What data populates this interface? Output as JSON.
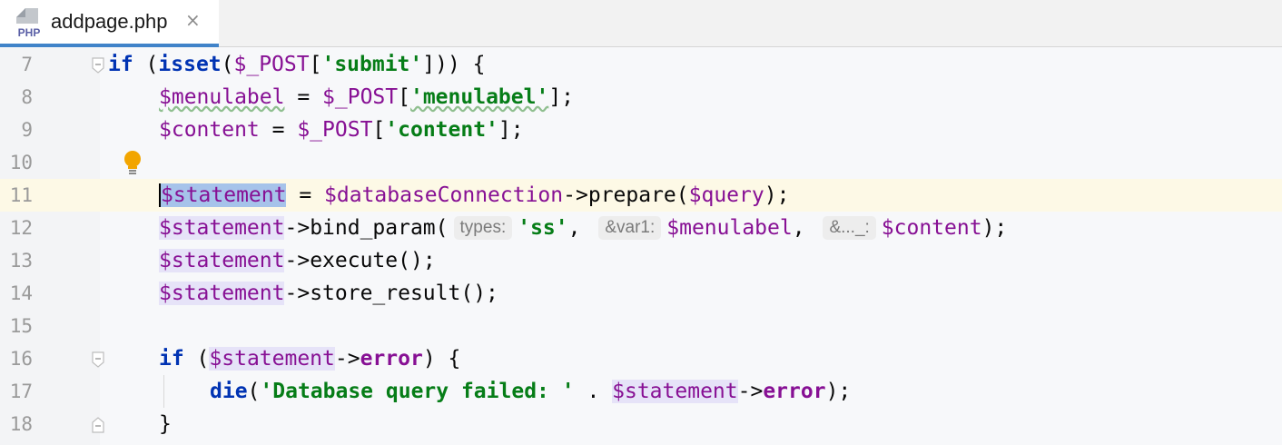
{
  "tab": {
    "filename": "addpage.php",
    "icon": "php-file-icon",
    "close": "×",
    "badge": "PHP"
  },
  "lines": [
    {
      "n": "7"
    },
    {
      "n": "8"
    },
    {
      "n": "9"
    },
    {
      "n": "10"
    },
    {
      "n": "11"
    },
    {
      "n": "12"
    },
    {
      "n": "13"
    },
    {
      "n": "14"
    },
    {
      "n": "15"
    },
    {
      "n": "16"
    },
    {
      "n": "17"
    },
    {
      "n": "18"
    }
  ],
  "tokens": {
    "l7": [
      "if",
      " (",
      "isset",
      "(",
      "$_POST",
      "[",
      "'submit'",
      "])) {"
    ],
    "l8": [
      "$menulabel",
      " = ",
      "$_POST",
      "[",
      "'menulabel'",
      "];"
    ],
    "l9": [
      "$content",
      " = ",
      "$_POST",
      "[",
      "'content'",
      "];"
    ],
    "l11": [
      "$statement",
      " = ",
      "$databaseConnection",
      "->",
      "prepare",
      "(",
      "$query",
      ");"
    ],
    "l12": [
      "$statement",
      "->",
      "bind_param",
      "(",
      "types:",
      "'ss'",
      ", ",
      "&var1:",
      "$menulabel",
      ", ",
      "&..._:",
      "$content",
      ");"
    ],
    "l13": [
      "$statement",
      "->",
      "execute",
      "();"
    ],
    "l14": [
      "$statement",
      "->",
      "store_result",
      "();"
    ],
    "l16": [
      "if",
      " (",
      "$statement",
      "->",
      "error",
      ") {"
    ],
    "l17": [
      "die",
      "(",
      "'Database query failed: '",
      " . ",
      "$statement",
      "->",
      "error",
      ");"
    ],
    "l18": [
      "}"
    ]
  },
  "colors": {
    "keyword": "#0033b3",
    "variable": "#871094",
    "string": "#067d17",
    "caret_line": "#fdf9e6",
    "selection": "#a6c3ea",
    "tab_underline": "#4083c9"
  }
}
